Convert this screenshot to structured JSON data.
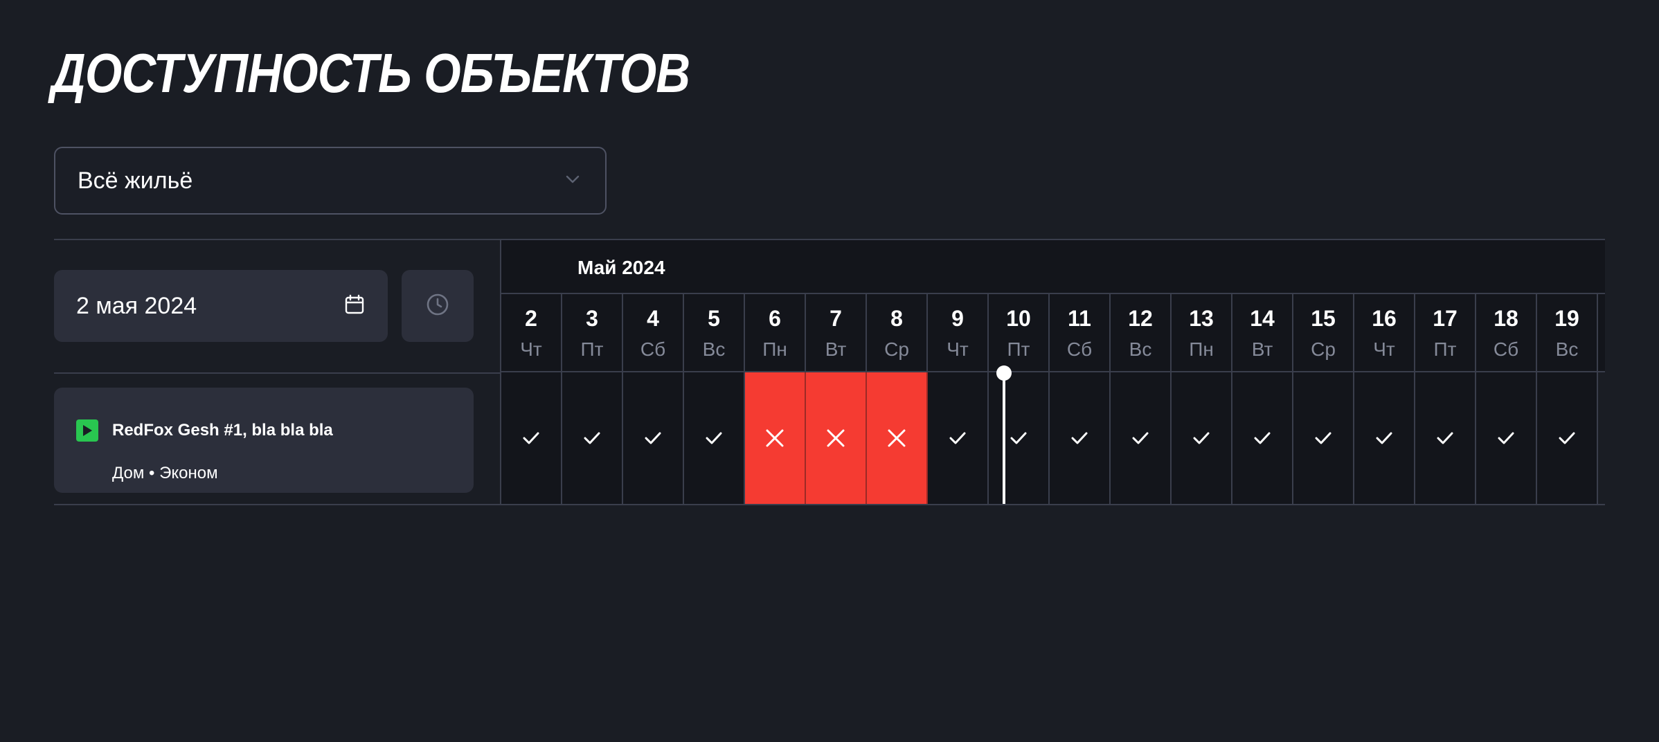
{
  "page": {
    "title": "ДОСТУПНОСТЬ ОБЪЕКТОВ"
  },
  "filter": {
    "selected": "Всё жильё",
    "chevron_icon": "chevron-down-icon"
  },
  "date_picker": {
    "value": "2 мая 2024",
    "icon": "calendar-icon"
  },
  "time_button": {
    "icon": "clock-icon"
  },
  "calendar": {
    "month": "Май 2024",
    "days": [
      {
        "day": "2",
        "weekday": "Чт"
      },
      {
        "day": "3",
        "weekday": "Пт"
      },
      {
        "day": "4",
        "weekday": "Сб"
      },
      {
        "day": "5",
        "weekday": "Вс"
      },
      {
        "day": "6",
        "weekday": "Пн"
      },
      {
        "day": "7",
        "weekday": "Вт"
      },
      {
        "day": "8",
        "weekday": "Ср"
      },
      {
        "day": "9",
        "weekday": "Чт"
      },
      {
        "day": "10",
        "weekday": "Пт"
      },
      {
        "day": "11",
        "weekday": "Сб"
      },
      {
        "day": "12",
        "weekday": "Вс"
      },
      {
        "day": "13",
        "weekday": "Пн"
      },
      {
        "day": "14",
        "weekday": "Вт"
      },
      {
        "day": "15",
        "weekday": "Ср"
      },
      {
        "day": "16",
        "weekday": "Чт"
      },
      {
        "day": "17",
        "weekday": "Пт"
      },
      {
        "day": "18",
        "weekday": "Сб"
      },
      {
        "day": "19",
        "weekday": "Вс"
      }
    ]
  },
  "objects": [
    {
      "name": "RedFox Gesh #1, bla bla bla",
      "subtitle": "Дом • Эконом",
      "status_icon": "play-icon",
      "status_color": "#29c650",
      "availability": [
        "available",
        "available",
        "available",
        "available",
        "booked",
        "booked",
        "booked",
        "available",
        "available",
        "available",
        "available",
        "available",
        "available",
        "available",
        "available",
        "available",
        "available",
        "available"
      ]
    }
  ],
  "colors": {
    "background": "#1a1d24",
    "panel": "#2c2f3b",
    "booked": "#f53b32",
    "available_bg": "#13151b",
    "accent_green": "#29c650"
  }
}
